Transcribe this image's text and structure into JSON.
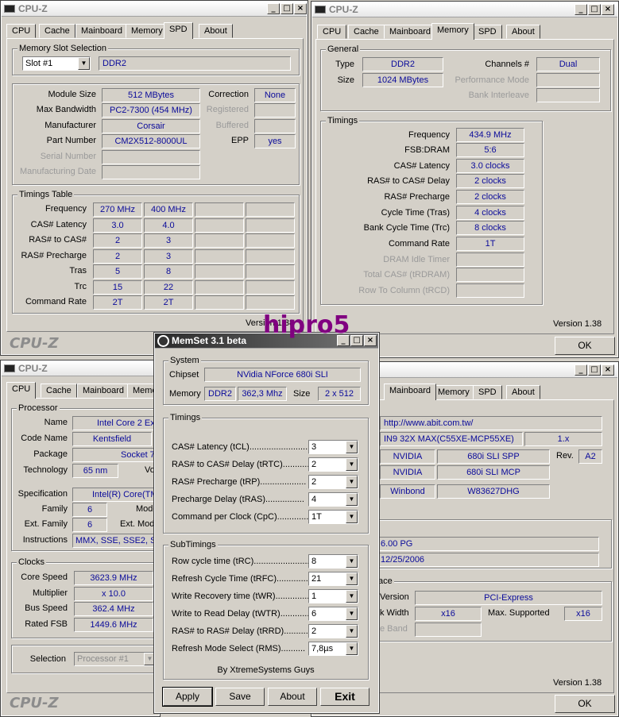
{
  "watermark": "hipro5",
  "cpuz_tabs": [
    "CPU",
    "Cache",
    "Mainboard",
    "Memory",
    "SPD",
    "About"
  ],
  "brand": "CPU-Z",
  "version": "Version 1.38",
  "ok_label": "OK",
  "spd": {
    "title": "CPU-Z",
    "slot_group": "Memory Slot Selection",
    "slot_selected": "Slot #1",
    "slot_type": "DDR2",
    "rows": [
      {
        "label": "Module Size",
        "value": "512 MBytes"
      },
      {
        "label": "Max Bandwidth",
        "value": "PC2-7300 (454 MHz)"
      },
      {
        "label": "Manufacturer",
        "value": "Corsair"
      },
      {
        "label": "Part Number",
        "value": "CM2X512-8000UL"
      },
      {
        "label": "Serial Number",
        "value": ""
      },
      {
        "label": "Manufacturing Date",
        "value": ""
      }
    ],
    "right_rows": [
      {
        "label": "Correction",
        "value": "None"
      },
      {
        "label": "Registered",
        "value": ""
      },
      {
        "label": "Buffered",
        "value": ""
      },
      {
        "label": "EPP",
        "value": "yes"
      }
    ],
    "timings_group": "Timings Table",
    "timings_labels": [
      "Frequency",
      "CAS# Latency",
      "RAS# to CAS#",
      "RAS# Precharge",
      "Tras",
      "Trc",
      "Command Rate"
    ],
    "timings_col1": [
      "270 MHz",
      "3.0",
      "2",
      "2",
      "5",
      "15",
      "2T"
    ],
    "timings_col2": [
      "400 MHz",
      "4.0",
      "3",
      "3",
      "8",
      "22",
      "2T"
    ],
    "version": "Version 1.38"
  },
  "memory": {
    "title": "CPU-Z",
    "general_group": "General",
    "type_label": "Type",
    "type_value": "DDR2",
    "size_label": "Size",
    "size_value": "1024 MBytes",
    "channels_label": "Channels #",
    "channels_value": "Dual",
    "perf_label": "Performance Mode",
    "bank_label": "Bank Interleave",
    "timings_group": "Timings",
    "rows": [
      {
        "label": "Frequency",
        "value": "434.9 MHz"
      },
      {
        "label": "FSB:DRAM",
        "value": "5:6"
      },
      {
        "label": "CAS# Latency",
        "value": "3.0 clocks"
      },
      {
        "label": "RAS# to CAS# Delay",
        "value": "2 clocks"
      },
      {
        "label": "RAS# Precharge",
        "value": "2 clocks"
      },
      {
        "label": "Cycle Time (Tras)",
        "value": "4 clocks"
      },
      {
        "label": "Bank Cycle Time (Trc)",
        "value": "8 clocks"
      },
      {
        "label": "Command Rate",
        "value": "1T"
      },
      {
        "label": "DRAM Idle Timer",
        "value": ""
      },
      {
        "label": "Total CAS# (tRDRAM)",
        "value": ""
      },
      {
        "label": "Row To Column (tRCD)",
        "value": ""
      }
    ]
  },
  "cpu": {
    "title": "CPU-Z",
    "processor_group": "Processor",
    "name_label": "Name",
    "name_value": "Intel Core 2 Ext",
    "codename_label": "Code Name",
    "codename_value": "Kentsfield",
    "package_label": "Package",
    "package_value": "Socket 7",
    "tech_label": "Technology",
    "tech_value": "65 nm",
    "tech_right": "Vo",
    "spec_label": "Specification",
    "spec_value": "Intel(R) Core(TM",
    "family_label": "Family",
    "family_value": "6",
    "model_label": "Mode",
    "extfamily_label": "Ext. Family",
    "extfamily_value": "6",
    "extmodel_label": "Ext. Mod",
    "instr_label": "Instructions",
    "instr_value": "MMX, SSE, SSE2, SS",
    "clocks_group": "Clocks",
    "core_label": "Core Speed",
    "core_value": "3623.9 MHz",
    "mult_label": "Multiplier",
    "mult_value": "x 10.0",
    "bus_label": "Bus Speed",
    "bus_value": "362.4 MHz",
    "fsb_label": "Rated FSB",
    "fsb_value": "1449.6 MHz",
    "selection_label": "Selection",
    "selection_value": "Processor #1"
  },
  "mainboard": {
    "url": "http://www.abit.com.tw/",
    "model": "IN9 32X MAX(C55XE-MCP55XE)",
    "model_ver": "1.x",
    "chipset_vendor": "NVIDIA",
    "chipset": "680i SLI SPP",
    "rev_label": "Rev.",
    "rev": "A2",
    "south_vendor": "NVIDIA",
    "south": "680i SLI MCP",
    "lpc_vendor": "Winbond",
    "lpc": "W83627DHG",
    "bios_version": "6.00 PG",
    "bios_date": "12/25/2006",
    "graphic_group_partial": "ace",
    "gi_version_label": "Version",
    "gi_version": "PCI-Express",
    "gi_width_label": "k Width",
    "gi_width": "x16",
    "gi_max_label": "Max. Supported",
    "gi_max": "x16",
    "gi_band_label": "e Band",
    "version": "Version 1.38"
  },
  "memset": {
    "title": "MemSet 3.1 beta",
    "system_group": "System",
    "chipset_label": "Chipset",
    "chipset_value": "NVidia NForce 680i SLI",
    "memory_label": "Memory",
    "memory_type": "DDR2",
    "memory_speed": "362,3 Mhz",
    "size_label": "Size",
    "size_value": "2 x 512",
    "timings_group": "Timings",
    "timings": [
      {
        "label": "CAS# Latency (tCL).........................",
        "value": "3"
      },
      {
        "label": "RAS# to CAS# Delay (tRTC)...........",
        "value": "2"
      },
      {
        "label": "RAS# Precharge (tRP)...................",
        "value": "2"
      },
      {
        "label": "Precharge Delay  (tRAS)................",
        "value": "4"
      },
      {
        "label": "Command per Clock (CpC)..............",
        "value": "1T"
      }
    ],
    "sub_group": "SubTimings",
    "subtimings": [
      {
        "label": "Row cycle time (tRC).......................",
        "value": "8"
      },
      {
        "label": "Refresh Cycle Time (tRFC)...............",
        "value": "21"
      },
      {
        "label": "Write Recovery time (tWR)..............",
        "value": "1"
      },
      {
        "label": "Write to Read Delay (tWTR)............",
        "value": "6"
      },
      {
        "label": "RAS# to RAS# Delay (tRRD)............",
        "value": "2"
      },
      {
        "label": "Refresh Mode Select (RMS)..........",
        "value": "7,8µs"
      }
    ],
    "credit": "By XtremeSystems Guys",
    "apply": "Apply",
    "save": "Save",
    "about": "About",
    "exit": "Exit"
  }
}
